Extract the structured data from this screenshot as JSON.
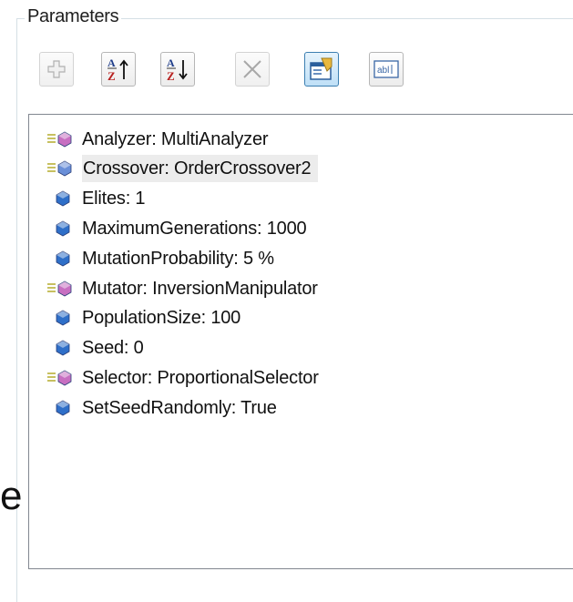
{
  "group": {
    "title": "Parameters"
  },
  "toolbar": {
    "buttons": [
      {
        "name": "add",
        "icon": "plus-icon",
        "enabled": false
      },
      {
        "name": "sort-ascending",
        "icon": "sort-az-ascending-icon",
        "enabled": true
      },
      {
        "name": "sort-descending",
        "icon": "sort-az-descending-icon",
        "enabled": true
      },
      {
        "name": "remove",
        "icon": "x-icon",
        "enabled": false
      },
      {
        "name": "show-parameter-details",
        "icon": "detail-view-icon",
        "active": true
      },
      {
        "name": "text-edit",
        "icon": "textbox-icon",
        "enabled": true
      }
    ]
  },
  "parameters": [
    {
      "label": "Analyzer: MultiAnalyzer",
      "kind": "operator",
      "color": "#c76fc1"
    },
    {
      "label": "Crossover: OrderCrossover2",
      "kind": "operator",
      "color": "#6a8fd8",
      "selected": true
    },
    {
      "label": "Elites: 1",
      "kind": "value",
      "color": "#2f6fc8"
    },
    {
      "label": "MaximumGenerations: 1000",
      "kind": "value",
      "color": "#2f6fc8"
    },
    {
      "label": "MutationProbability: 5 %",
      "kind": "value",
      "color": "#2f6fc8"
    },
    {
      "label": "Mutator: InversionManipulator",
      "kind": "operator",
      "color": "#c76fc1"
    },
    {
      "label": "PopulationSize: 100",
      "kind": "value",
      "color": "#2f6fc8"
    },
    {
      "label": "Seed: 0",
      "kind": "value",
      "color": "#2f6fc8"
    },
    {
      "label": "Selector: ProportionalSelector",
      "kind": "operator",
      "color": "#c76fc1"
    },
    {
      "label": "SetSeedRandomly: True",
      "kind": "value",
      "color": "#2f6fc8"
    }
  ],
  "cut_text": "e"
}
